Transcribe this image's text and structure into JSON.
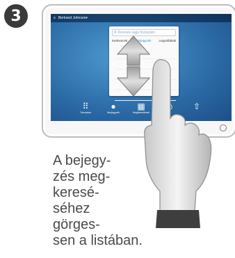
{
  "step": {
    "number": "3"
  },
  "device": {
    "statusbar": {
      "user": "Bertrand Johnson",
      "indicator": "▾",
      "right_a": "",
      "right_b": ""
    },
    "panel": {
      "search_placeholder": "Keresés vagy hívószám",
      "tabs": [
        "Kedvencek",
        "Névjegyzék",
        "Legutóbbiak"
      ],
      "entries": [
        "",
        "",
        "",
        "",
        ""
      ]
    },
    "dock": [
      {
        "icon": "grid-icon",
        "label": "Tárcsázás"
      },
      {
        "icon": "person-icon",
        "label": "Névjegyzék"
      },
      {
        "icon": "calendar-icon",
        "label": "Megbeszélések"
      },
      {
        "icon": "share-icon",
        "label": ""
      },
      {
        "icon": "present-icon",
        "label": ""
      }
    ]
  },
  "caption": "A bejegy-\nzés meg-\nkeresé-\nséhez\ngörges-\nsen a listában.",
  "colors": {
    "screen": "#2f6fa8",
    "accent": "#2a8fd6",
    "caption": "#4a4a4a"
  }
}
